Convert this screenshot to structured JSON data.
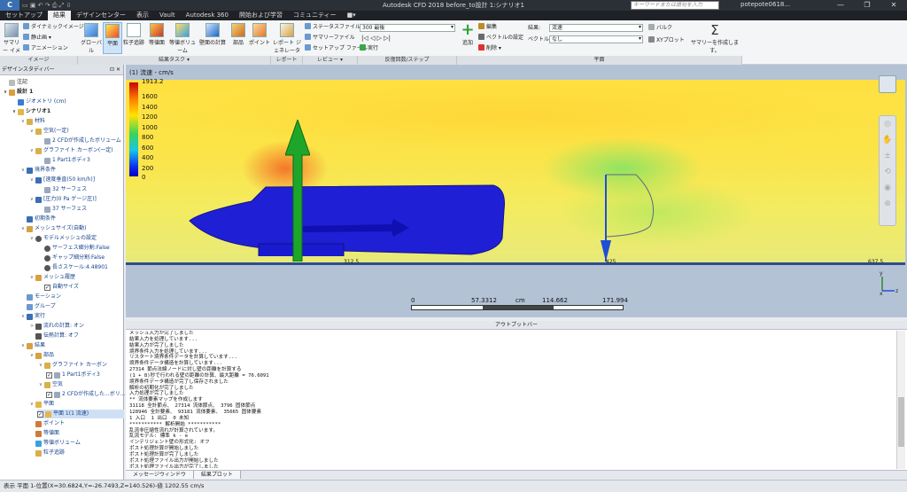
{
  "window": {
    "app_button": "C",
    "title": "Autodesk CFD 2018   before_to設計 1:シナリオ1",
    "search_placeholder": "キーワードまたは語句を入力",
    "user": "potepote0618...",
    "controls": [
      "—",
      "❐",
      "✕"
    ]
  },
  "ribbon_tabs": [
    "セットアップ",
    "結果",
    "デザインセンター",
    "表示",
    "Vault",
    "Autodesk 360",
    "開始および学習",
    "コミュニティー",
    "■▾"
  ],
  "active_tab": "結果",
  "ribbon": {
    "image_group": {
      "label": "イメージ",
      "summary_image": "サマリー イメージ",
      "dynamic_image": "ダイナミックイメージ",
      "still_image": "静止画 ▾",
      "animation": "アニメーション"
    },
    "result_tasks": {
      "label": "結果タスク ▾",
      "buttons": [
        "グローバル",
        "平面",
        "粒子追跡",
        "等値面",
        "等値ボリューム",
        "壁面の計算",
        "部品",
        "ポイント"
      ],
      "selected": "平面"
    },
    "report": {
      "label": "レポート",
      "button": "レポート ジェネレータ"
    },
    "review": {
      "label": "レビュー ▾",
      "status_file": "ステータスファイル",
      "summary_file": "サマリーファイル",
      "setup_file": "セットアップ ファイル"
    },
    "iterations": {
      "label": "反復回数/ステップ",
      "combo": "300 最後",
      "playback": "|◁ ◁ ▷ ▷|",
      "run": "実行"
    },
    "plane": {
      "label": "平面",
      "add": "追加",
      "edit": "編集",
      "vector_settings": "ベクトルの設定",
      "delete": "削除 ▾",
      "result_label": "結果:",
      "result_value": "流速",
      "vector_label": "ベクトル:",
      "vector_value": "なし",
      "bulk": "バルク",
      "xy_plot": "XYプロット",
      "summary": "サマリーを作成します。"
    }
  },
  "left_panel": {
    "header": "デザインスタディバー",
    "header_ctl": "⊡ ✕",
    "items": [
      {
        "text": "注記"
      },
      {
        "text": "設計 1"
      },
      {
        "text": "ジオメトリ (cm)"
      },
      {
        "text": "シナリオ1"
      },
      {
        "text": "材料"
      },
      {
        "text": "空気(一定)"
      },
      {
        "text": "2 CFDが作成したボリューム"
      },
      {
        "text": "グラファイト カーボン(一定)"
      },
      {
        "text": "1 Part1ボディ3"
      },
      {
        "text": "境界条件"
      },
      {
        "text": "[速度垂直(50 km/h)]"
      },
      {
        "text": "32 サーフェス"
      },
      {
        "text": "[圧力(0 Pa ゲージ圧)]"
      },
      {
        "text": "37 サーフェス"
      },
      {
        "text": "初期条件"
      },
      {
        "text": "メッシュサイズ(自動)"
      },
      {
        "text": "モデルメッシュの設定"
      },
      {
        "text": "サーフェス細分割:False"
      },
      {
        "text": "ギャップ細分割:False"
      },
      {
        "text": "長さスケール:4.48901"
      },
      {
        "text": "メッシュ履歴"
      },
      {
        "text": "自動サイズ"
      },
      {
        "text": "モーション"
      },
      {
        "text": "グループ"
      },
      {
        "text": "実行"
      },
      {
        "text": "流れの計算: オン"
      },
      {
        "text": "伝熱計算: オフ"
      },
      {
        "text": "結果"
      },
      {
        "text": "部品"
      },
      {
        "text": "グラファイト カーボン"
      },
      {
        "text": "1 Part1ボディ3"
      },
      {
        "text": "空気"
      },
      {
        "text": "2 CFDが作成した...ボリ..."
      },
      {
        "text": "平面"
      },
      {
        "text": "平面 1(1 流速)"
      },
      {
        "text": "ポイント"
      },
      {
        "text": "等値面"
      },
      {
        "text": "等値ボリューム"
      },
      {
        "text": "粒子追跡"
      }
    ]
  },
  "viewport": {
    "label": "(1) 流速 - cm/s",
    "legend_max": "1913.2",
    "legend_ticks": [
      "1600",
      "1400",
      "1200",
      "1000",
      "800",
      "600",
      "400",
      "200",
      "0"
    ],
    "axis_ticks": [
      "312.5",
      "425",
      "637.5"
    ],
    "ruler_ticks": [
      "0",
      "57.3312",
      "cm",
      "114.662",
      "171.994"
    ],
    "triad": {
      "y": "y",
      "z": "z",
      "x": "x"
    }
  },
  "output": {
    "title": "アウトプットバー",
    "lines": [
      "メッシュ入力が完了しました",
      "結果入力を処理しています...",
      "結果入力が完了しました",
      "境界条件入力を処理しています...",
      "リスタート境界条件データを計算しています...",
      "境界条件データ構造を計算しています...",
      "27314 節点法線ノードに対し壁の距離を計算する",
      "(1 + 8)秒で行われる壁の距離の計算、最大距離 = 76.6091",
      "境界条件データ構造が完了し保存されました",
      "解析の初期化が完了しました",
      "入力処理が完了しました",
      "** 流体要素マップを作成します",
      "31118 全計節点、 27314 流体節点、 3796 固体節点",
      "128946 全計要素、 93181 流体要素、 35665 固体要素",
      "1 入口  1 出口  0 未知",
      "*********** 解析開始 ***********",
      "乱流非圧縮性流れが計算されています。",
      "乱流モデル: 標準 k - e",
      "インテリジェント壁の形式化: オフ",
      "ポスト処理計算が開始しました",
      "ポスト処理計算が完了しました",
      "ポスト処理ファイル出力が開始しました",
      "ポスト処理ファイル出力が完了しました",
      "解析が正常に終了しました"
    ],
    "tabs": [
      "メッセージウィンドウ",
      "結果プロット"
    ]
  },
  "status": "表示 平面 1-位置(X=30.6824,Y=-26.7493,Z=140.526)-値 1202.55  cm/s",
  "colors": {
    "accent": "#3a6fb2",
    "title_bg": "#2b2f36",
    "tree_text": "#14418c"
  }
}
